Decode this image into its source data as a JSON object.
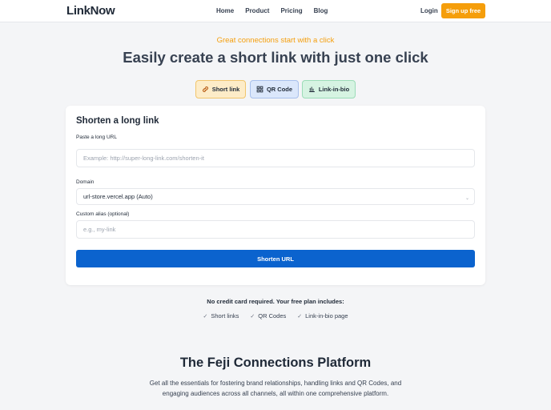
{
  "header": {
    "logo": "LinkNow",
    "nav": [
      "Home",
      "Product",
      "Pricing",
      "Blog"
    ],
    "login": "Login",
    "signup": "Sign up free"
  },
  "hero": {
    "tagline": "Great connections start with a click",
    "title": "Easily create a short link with just one click"
  },
  "tabs": [
    {
      "label": "Short link",
      "icon": "link-icon"
    },
    {
      "label": "QR Code",
      "icon": "qr-code-icon"
    },
    {
      "label": "Link-in-bio",
      "icon": "bar-chart-icon"
    }
  ],
  "form": {
    "title": "Shorten a long link",
    "url_label": "Paste a long URL",
    "url_placeholder": "Example: http://super-long-link.com/shorten-it",
    "domain_label": "Domain",
    "domain_value": "url-store.vercel.app (Auto)",
    "alias_label": "Custom alias (optional)",
    "alias_placeholder": "e.g., my-link",
    "submit": "Shorten URL"
  },
  "plan": {
    "note": "No credit card required. Your free plan includes:",
    "features": [
      "Short links",
      "QR Codes",
      "Link-in-bio page"
    ]
  },
  "platform": {
    "title": "The Feji Connections Platform",
    "description": "Get all the essentials for fostering brand relationships, handling links and QR Codes, and engaging audiences across all channels, all within one comprehensive platform."
  },
  "colors": {
    "accent": "#f59e0b",
    "primary_button": "#0b63ce"
  }
}
